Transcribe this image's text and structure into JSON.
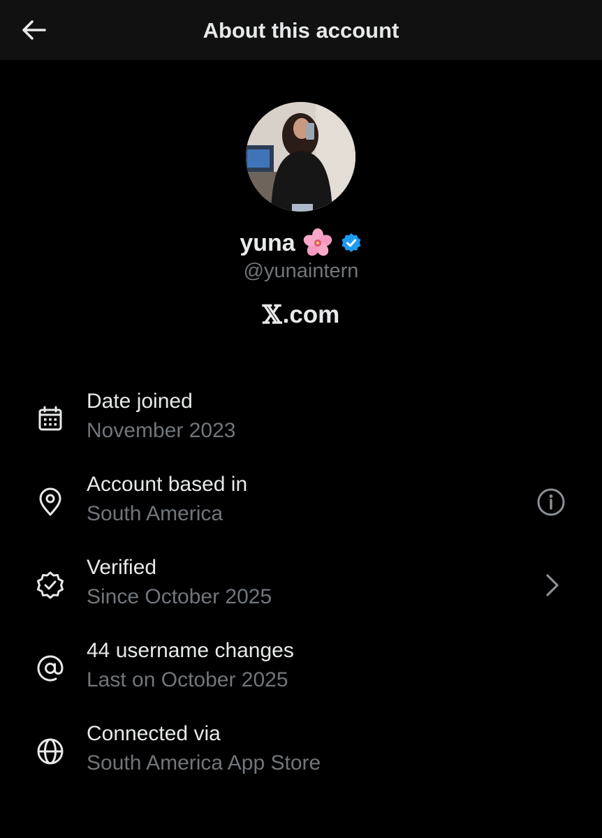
{
  "header": {
    "title": "About this account",
    "back_icon": "arrow-left-icon"
  },
  "profile": {
    "display_name": "yuna",
    "emoji": "🌸",
    "verified_badge_color": "#1d9bf0",
    "handle": "@yunaintern",
    "site_prefix": "𝕏",
    "site_suffix": ".com"
  },
  "details": [
    {
      "icon": "calendar-icon",
      "title": "Date joined",
      "subtitle": "November 2023"
    },
    {
      "icon": "location-pin-icon",
      "title": "Account based in",
      "subtitle": "South America",
      "action_icon": "info-icon"
    },
    {
      "icon": "verified-badge-icon",
      "title": "Verified",
      "subtitle": "Since October 2025",
      "action_icon": "chevron-right-icon"
    },
    {
      "icon": "at-sign-icon",
      "title": "44 username changes",
      "subtitle": "Last on October 2025"
    },
    {
      "icon": "globe-icon",
      "title": "Connected via",
      "subtitle": "South America App Store"
    }
  ],
  "colors": {
    "background": "#000000",
    "header_background": "#111111",
    "primary_text": "#e7e9ea",
    "secondary_text": "#71767b"
  }
}
